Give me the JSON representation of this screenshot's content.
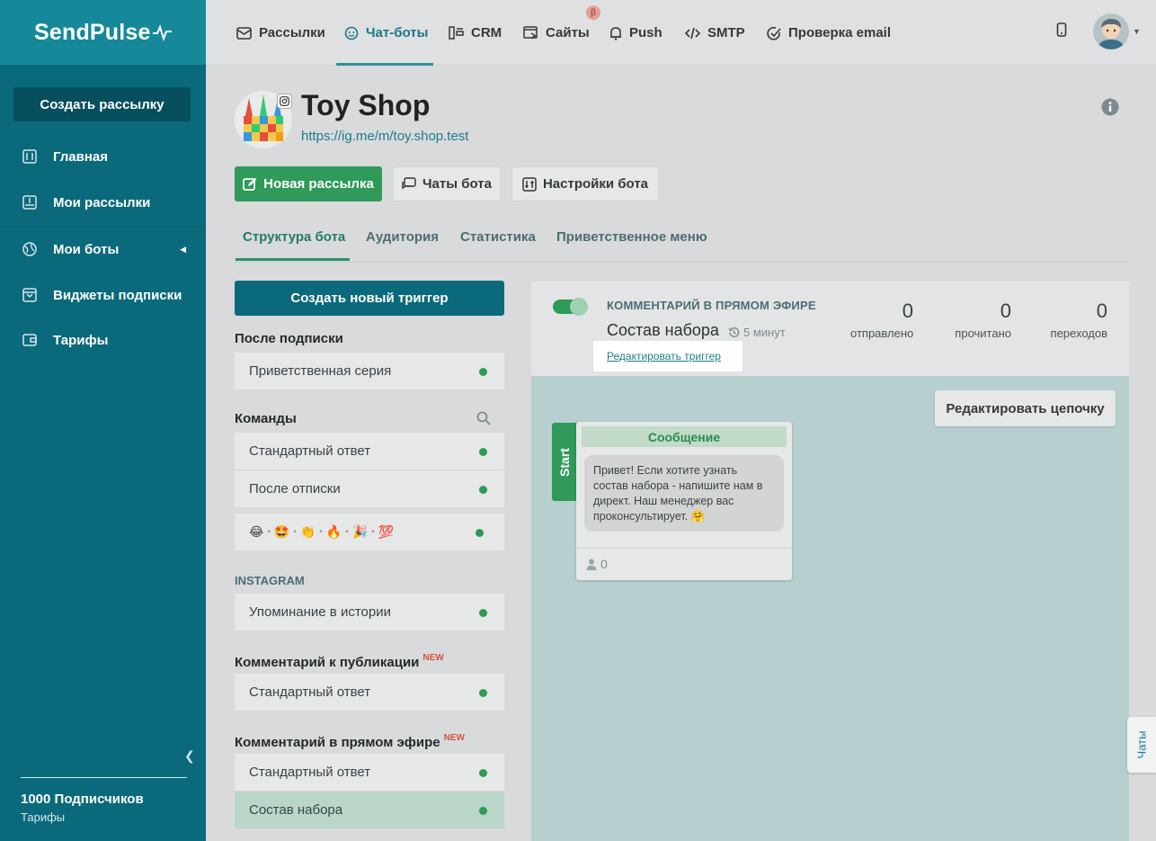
{
  "app": {
    "logo_text": "SendPulse"
  },
  "sidebar": {
    "create_button": "Создать рассылку",
    "items": [
      {
        "label": "Главная",
        "icon": "sliders-icon"
      },
      {
        "label": "Мои рассылки",
        "icon": "inbox-icon"
      },
      {
        "label": "Мои боты",
        "icon": "globe-icon"
      },
      {
        "label": "Виджеты подписки",
        "icon": "widget-icon"
      },
      {
        "label": "Тарифы",
        "icon": "wallet-icon"
      }
    ],
    "subscribers": "1000 Подписчиков",
    "plan": "Тарифы"
  },
  "topnav": {
    "items": [
      {
        "label": "Рассылки",
        "icon": "mail-icon"
      },
      {
        "label": "Чат-боты",
        "icon": "chatbot-icon"
      },
      {
        "label": "CRM",
        "icon": "crm-icon"
      },
      {
        "label": "Сайты",
        "icon": "site-icon"
      },
      {
        "label": "Push",
        "icon": "bell-icon"
      },
      {
        "label": "SMTP",
        "icon": "code-icon"
      },
      {
        "label": "Проверка email",
        "icon": "check-circle-icon"
      }
    ],
    "beta_badge": "β"
  },
  "bot": {
    "title": "Toy Shop",
    "link": "https://ig.me/m/toy.shop.test"
  },
  "actions": {
    "new_mailing": "Новая рассылка",
    "bot_chats": "Чаты бота",
    "bot_settings": "Настройки бота"
  },
  "tabs": [
    "Структура бота",
    "Аудитория",
    "Статистика",
    "Приветственное меню"
  ],
  "triggers": {
    "create_button": "Создать новый триггер",
    "sections": {
      "after_subscribe": "После подписки",
      "commands": "Команды",
      "instagram": "INSTAGRAM",
      "post_comment": "Комментарий к публикации",
      "live_comment": "Комментарий в прямом эфире",
      "new_badge": "NEW"
    },
    "items": {
      "welcome_series": "Приветственная серия",
      "standard_reply_1": "Стандартный ответ",
      "after_unsubscribe": "После отписки",
      "emojis": [
        "😂",
        "🤩",
        "👏",
        "🔥",
        "🎉",
        "💯"
      ],
      "story_mention": "Упоминание в истории",
      "standard_reply_2": "Стандартный ответ",
      "standard_reply_3": "Стандартный ответ",
      "kit_contents": "Состав набора"
    }
  },
  "trigger_detail": {
    "type": "КОММЕНТАРИЙ В ПРЯМОМ ЭФИРЕ",
    "name": "Состав набора",
    "delay": "5 минут",
    "edit_link": "Редактировать триггер",
    "stats": [
      {
        "value": "0",
        "label": "отправлено"
      },
      {
        "value": "0",
        "label": "прочитано"
      },
      {
        "value": "0",
        "label": "переходов"
      }
    ]
  },
  "flow": {
    "edit_chain": "Редактировать цепочку",
    "start_label": "Start",
    "message": {
      "header": "Сообщение",
      "text": "Привет! Если хотите узнать состав набора - напишите нам в директ.  Наш менеджер вас проконсультирует. 🤗",
      "subscribers": "0"
    }
  },
  "chats_tab": "Чаты",
  "colors": {
    "sidebar": "#0a6a7c",
    "accent": "#2f9a5a",
    "link": "#1b7d8c"
  }
}
